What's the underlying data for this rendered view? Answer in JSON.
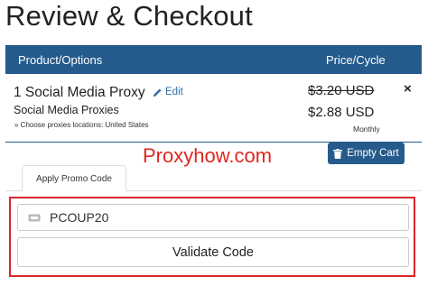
{
  "page": {
    "title": "Review & Checkout"
  },
  "cart": {
    "columns": {
      "product": "Product/Options",
      "price": "Price/Cycle"
    },
    "item": {
      "name": "1 Social Media Proxy",
      "edit_label": "Edit",
      "group": "Social Media Proxies",
      "option": "» Choose proxies locations: United States",
      "old_price": "$3.20 USD",
      "price": "$2.88 USD",
      "cycle": "Monthly",
      "remove_symbol": "×"
    },
    "empty_cart_label": "Empty Cart"
  },
  "watermark": "Proxyhow.com",
  "promo": {
    "tab_label": "Apply Promo Code",
    "code_value": "PCOUP20",
    "validate_label": "Validate Code"
  },
  "colors": {
    "header_bg": "#255b8c",
    "highlight": "#d8262a",
    "watermark": "#e0271f",
    "link": "#2e6da4"
  },
  "icons": {
    "edit": "pencil-icon",
    "remove": "close-icon",
    "empty_cart": "trash-icon",
    "promo": "ticket-icon"
  }
}
